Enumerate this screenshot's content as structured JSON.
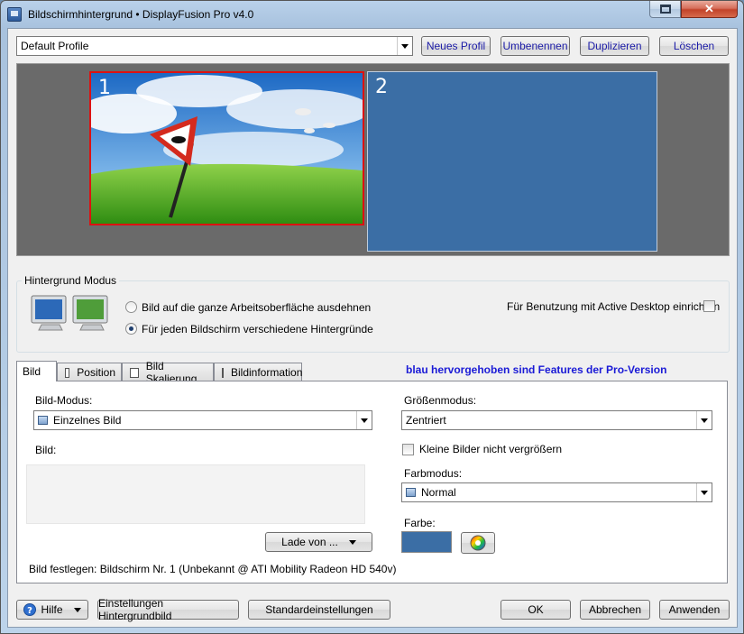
{
  "window": {
    "title": "Bildschirmhintergrund • DisplayFusion Pro v4.0",
    "close_label": "✕"
  },
  "profile": {
    "selected": "Default Profile",
    "buttons": {
      "new": "Neues Profil",
      "rename": "Umbenennen",
      "duplicate": "Duplizieren",
      "delete": "Löschen"
    }
  },
  "monitors": [
    {
      "number": "1"
    },
    {
      "number": "2"
    }
  ],
  "mode_group": {
    "legend": "Hintergrund Modus",
    "option_stretch": "Bild auf die ganze Arbeitsoberfläche ausdehnen",
    "option_each": "Für jeden Bildschirm verschiedene Hintergründe",
    "selected": "each",
    "active_desktop": "Für Benutzung mit Active Desktop einrichten",
    "active_desktop_checked": false
  },
  "tabs": [
    {
      "label": "Bild",
      "active": true
    },
    {
      "label": "Position"
    },
    {
      "label": "Bild Skalierung"
    },
    {
      "label": "Bildinformation"
    }
  ],
  "pro_note": "blau hervorgehoben sind Features der Pro-Version",
  "image_tab": {
    "mode_label": "Bild-Modus:",
    "mode_value": "Einzelnes Bild",
    "image_label": "Bild:",
    "load_button": "Lade von ...",
    "status": "Bild festlegen: Bildschirm Nr. 1 (Unbekannt @ ATI Mobility Radeon HD 540v)",
    "size_mode_label": "Größenmodus:",
    "size_mode_value": "Zentriert",
    "no_enlarge_label": "Kleine Bilder nicht vergrößern",
    "no_enlarge_checked": false,
    "color_mode_label": "Farbmodus:",
    "color_mode_value": "Normal",
    "color_label": "Farbe:",
    "color_value": "#3b6ea5"
  },
  "footer": {
    "help": "Hilfe",
    "wallpaper_settings": "Einstellungen Hintergrundbild",
    "defaults": "Standardeinstellungen",
    "ok": "OK",
    "cancel": "Abbrechen",
    "apply": "Anwenden"
  }
}
